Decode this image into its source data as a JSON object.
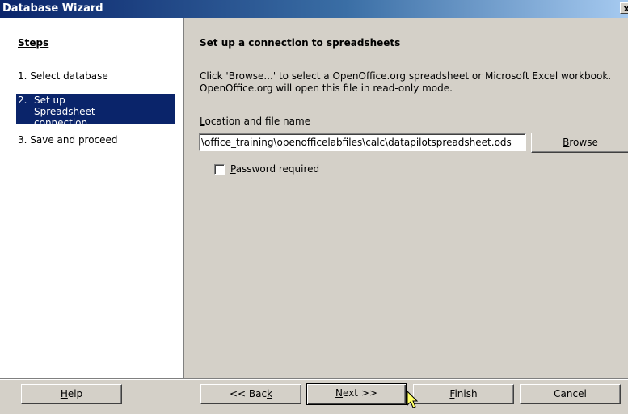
{
  "window": {
    "title": "Database Wizard",
    "close_glyph": "x"
  },
  "sidebar": {
    "heading": "Steps",
    "steps": [
      {
        "number": "1.",
        "label": "Select database",
        "active": false
      },
      {
        "number": "2.",
        "label": "Set up Spreadsheet connection",
        "active": true
      },
      {
        "number": "3.",
        "label": "Save and proceed",
        "active": false
      }
    ]
  },
  "main": {
    "title": "Set up a connection to spreadsheets",
    "description": "Click 'Browse...' to select a OpenOffice.org spreadsheet or Microsoft Excel workbook.\nOpenOffice.org will open this file in read-only mode.",
    "location_label_access": "L",
    "location_label_rest": "ocation and file name",
    "location_value": "\\office_training\\openofficelabfiles\\calc\\datapilotspreadsheet.ods",
    "browse_button_access": "B",
    "browse_button_rest": "rowse",
    "password_checkbox_access": "P",
    "password_checkbox_rest": "assword required",
    "password_checked": false
  },
  "footer": {
    "help_access": "H",
    "help_rest": "elp",
    "back_prefix": "<< Bac",
    "back_access": "k",
    "next_access": "N",
    "next_rest": "ext >>",
    "finish_access": "F",
    "finish_rest": "inish",
    "cancel_label": "Cancel"
  },
  "colors": {
    "title_bar": "#0a246a",
    "selection": "#0a246a",
    "face": "#d4d0c8"
  },
  "icons": {
    "cursor": "mouse-pointer-icon"
  }
}
